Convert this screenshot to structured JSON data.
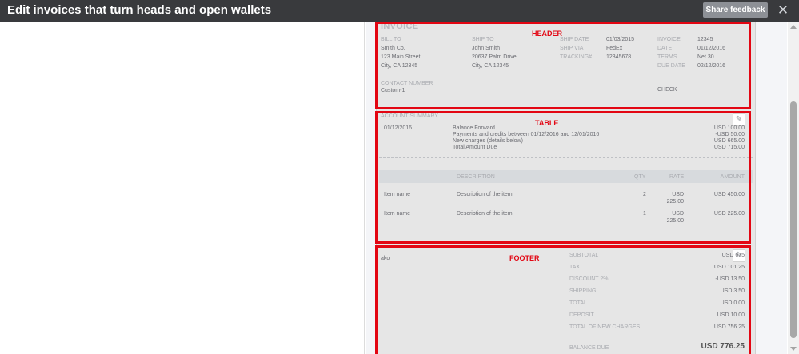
{
  "topbar": {
    "title": "Edit invoices that turn heads and open wallets",
    "feedback_label": "Share feedback",
    "close_glyph": "✕"
  },
  "invoice": {
    "title": "INVOICE",
    "bill_to_label": "BILL TO",
    "bill_to_lines": [
      "Smith Co.",
      "123 Main Street",
      "City, CA 12345"
    ],
    "ship_to_label": "SHIP TO",
    "ship_to_lines": [
      "John Smith",
      "20637 Palm Drive",
      "City, CA 12345"
    ],
    "ship_fields": [
      {
        "label": "SHIP DATE",
        "value": "01/03/2015"
      },
      {
        "label": "SHIP VIA",
        "value": "FedEx"
      },
      {
        "label": "TRACKING#",
        "value": "12345678"
      }
    ],
    "invoice_fields": [
      {
        "label": "INVOICE",
        "value": "12345"
      },
      {
        "label": "DATE",
        "value": "01/12/2016"
      },
      {
        "label": "TERMS",
        "value": "Net 30"
      },
      {
        "label": "DUE DATE",
        "value": "02/12/2016"
      }
    ],
    "contact_label": "CONTACT NUMBER",
    "contact_value": "Custom-1",
    "check_label": "CHECK"
  },
  "summary": {
    "title": "ACCOUNT SUMMARY",
    "date": "01/12/2016",
    "lines": [
      {
        "text": "Balance Forward",
        "amount": "USD 100.00"
      },
      {
        "text": "Payments and credits between 01/12/2016 and 12/01/2016",
        "amount": "-USD 50.00"
      },
      {
        "text": "New charges (details below)",
        "amount": "USD 665.00"
      },
      {
        "text": "Total Amount Due",
        "amount": "USD 715.00"
      }
    ]
  },
  "items_table": {
    "headers": {
      "description": "DESCRIPTION",
      "qty": "QTY",
      "rate": "RATE",
      "amount": "AMOUNT"
    },
    "rows": [
      {
        "name": "Item name",
        "description": "Description of the item",
        "qty": "2",
        "rate_currency": "USD",
        "rate_value": "225.00",
        "amount": "USD 450.00"
      },
      {
        "name": "Item name",
        "description": "Description of the item",
        "qty": "1",
        "rate_currency": "USD",
        "rate_value": "225.00",
        "amount": "USD 225.00"
      }
    ]
  },
  "footer": {
    "note": "ako",
    "totals": [
      {
        "label": "SUBTOTAL",
        "value": "USD 675"
      },
      {
        "label": "TAX",
        "value": "USD 101.25"
      },
      {
        "label": "DISCOUNT 2%",
        "value": "-USD 13.50"
      },
      {
        "label": "SHIPPING",
        "value": "USD 3.50"
      },
      {
        "label": "TOTAL",
        "value": "USD 0.00"
      },
      {
        "label": "DEPOSIT",
        "value": "USD 10.00"
      },
      {
        "label": "TOTAL OF NEW CHARGES",
        "value": "USD 756.25"
      }
    ],
    "balance_label": "BALANCE DUE",
    "balance_value": "USD 776.25"
  },
  "annotations": {
    "header": "HEADER",
    "table": "TABLE",
    "footer": "FOOTER",
    "color": "#e30613"
  },
  "icons": {
    "edit": "pencil-icon",
    "close": "close-icon"
  }
}
